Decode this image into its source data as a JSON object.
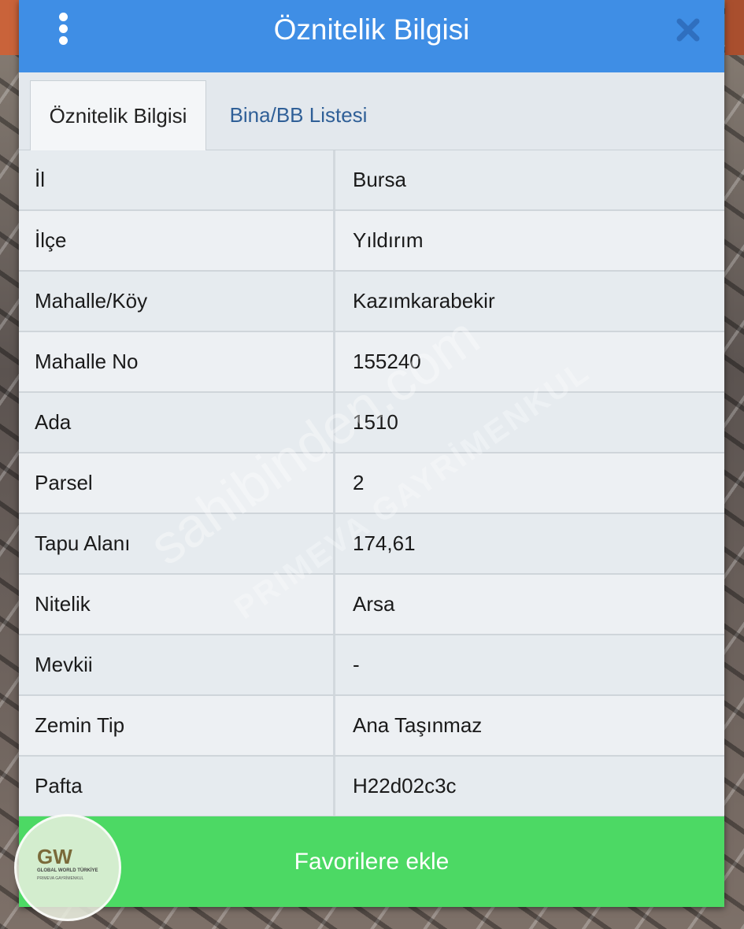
{
  "dialog": {
    "title": "Öznitelik Bilgisi",
    "menu_icon": "kebab-menu-icon",
    "close_icon": "close-icon"
  },
  "tabs": [
    {
      "label": "Öznitelik Bilgisi",
      "active": true
    },
    {
      "label": "Bina/BB Listesi",
      "active": false
    }
  ],
  "attributes": [
    {
      "label": "İl",
      "value": "Bursa"
    },
    {
      "label": "İlçe",
      "value": "Yıldırım"
    },
    {
      "label": "Mahalle/Köy",
      "value": "Kazımkarabekir"
    },
    {
      "label": "Mahalle No",
      "value": "155240"
    },
    {
      "label": "Ada",
      "value": "1510"
    },
    {
      "label": "Parsel",
      "value": "2"
    },
    {
      "label": "Tapu Alanı",
      "value": "174,61"
    },
    {
      "label": "Nitelik",
      "value": "Arsa"
    },
    {
      "label": "Mevkii",
      "value": "-"
    },
    {
      "label": "Zemin Tip",
      "value": "Ana Taşınmaz"
    },
    {
      "label": "Pafta",
      "value": "H22d02c3c"
    }
  ],
  "actions": {
    "favorite_label": "Favorilere ekle"
  },
  "watermark": {
    "text1": "sahibinden.com",
    "text2": "PRIMEVA GAYRİMENKUL"
  },
  "logo": {
    "mark": "GW",
    "line1": "GLOBAL WORLD TÜRKİYE",
    "line2": "PRIMEVA GAYRİMENKUL"
  },
  "colors": {
    "header": "#3f8ee5",
    "favorite_button": "#4cd964"
  }
}
